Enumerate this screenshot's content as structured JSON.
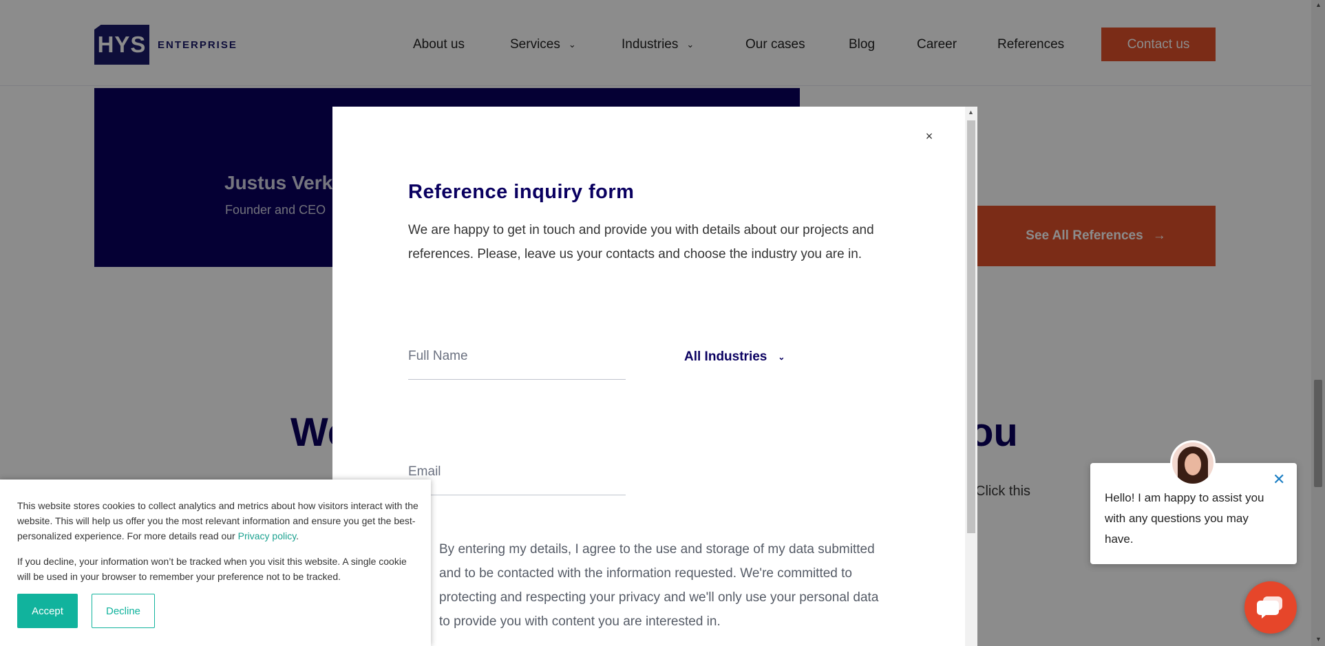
{
  "header": {
    "logo_mark": "HYS",
    "logo_text": "ENTERPRISE",
    "nav": [
      {
        "label": "About us"
      },
      {
        "label": "Services"
      },
      {
        "label": "Industries"
      },
      {
        "label": "Our cases"
      },
      {
        "label": "Blog"
      },
      {
        "label": "Career"
      },
      {
        "label": "References"
      }
    ],
    "contact_label": "Contact us"
  },
  "background": {
    "person_name": "Justus Verk",
    "person_role": "Founder and CEO",
    "see_all_label": "See All References",
    "heading_left": "We",
    "heading_right": "ou",
    "paragraph_fragment": "Click this"
  },
  "modal": {
    "close_label": "×",
    "title": "Reference inquiry form",
    "description": "We are happy to get in touch and provide you with details about our projects and references. Please, leave us your contacts and choose the industry you are in.",
    "full_name_placeholder": "Full Name",
    "industry_selected": "All Industries",
    "email_placeholder": "Email",
    "consent": "By entering my details, I agree to the use and storage of my data submitted and to be contacted with the information requested. We're committed to protecting and respecting your privacy and we'll only use your personal data to provide you with content you are interested in."
  },
  "cookie": {
    "text1_before_link": "This website stores cookies to collect analytics and metrics about how visitors interact with the website. This will help us offer you the most relevant information and ensure you get the best-personalized experience. For more details read our ",
    "link": "Privacy policy",
    "text1_after_link": ".",
    "text2": "If you decline, your information won’t be tracked when you visit this website. A single cookie will be used in your browser to remember your preference not to be tracked.",
    "accept": "Accept",
    "decline": "Decline"
  },
  "chat": {
    "message": "Hello! I am happy to assist you with any questions you may have."
  },
  "colors": {
    "brand_navy": "#0a0060",
    "accent_orange": "#e0512a",
    "cookie_teal": "#11b39d",
    "chat_red": "#e6462a"
  }
}
